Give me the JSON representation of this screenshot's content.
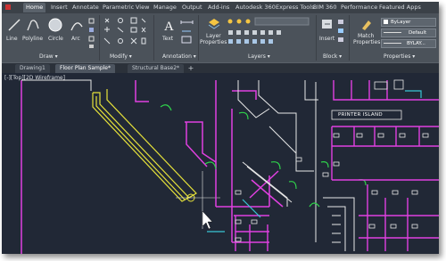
{
  "ribbon_tabs": [
    "Home",
    "Insert",
    "Annotate",
    "Parametric",
    "View",
    "Manage",
    "Output",
    "Add-ins",
    "Autodesk 360",
    "Express Tools",
    "BIM 360",
    "Performance",
    "Featured Apps"
  ],
  "active_tab": "Home",
  "draw": {
    "title": "Draw ▾",
    "line": "Line",
    "polyline": "Polyline",
    "circle": "Circle",
    "arc": "Arc"
  },
  "modify": {
    "title": "Modify ▾"
  },
  "annotation": {
    "title": "Annotation ▾",
    "text": "Text"
  },
  "layers": {
    "title": "Layers ▾",
    "layer_properties": "Layer\nProperties",
    "layer_properties_l1": "Layer",
    "layer_properties_l2": "Properties"
  },
  "block": {
    "title": "Block ▾",
    "insert": "Insert"
  },
  "properties": {
    "title": "Properties ▾",
    "match_l1": "Match",
    "match_l2": "Properties",
    "bylayer": "ByLayer",
    "default": "Default",
    "bylayer2": "BYLAY..."
  },
  "doc_tabs": [
    "Drawing1",
    "Floor Plan Sample*",
    "Structural Base2*"
  ],
  "active_doc": "Floor Plan Sample*",
  "new_tab": "+",
  "view_label": "[-][Top][2D Wireframe]",
  "drawing": {
    "printer_label": "PRINTER ISLAND"
  },
  "colors": {
    "ribbon": "#4b525a",
    "canvas": "#212836",
    "wall_magenta": "#e040e0",
    "wall_white": "#e8e8e8",
    "yellow": "#e6e23a",
    "green": "#2fd14b",
    "cyan": "#39c6d6"
  }
}
